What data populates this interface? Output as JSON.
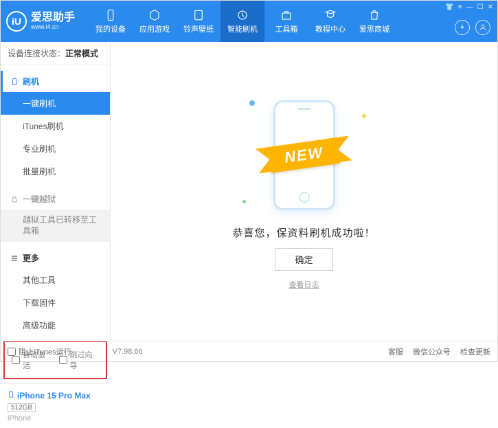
{
  "header": {
    "logo_text": "爱思助手",
    "logo_sub": "www.i4.cn",
    "logo_letter": "iU",
    "nav": [
      {
        "label": "我的设备"
      },
      {
        "label": "应用游戏"
      },
      {
        "label": "铃声壁纸"
      },
      {
        "label": "智能刷机"
      },
      {
        "label": "工具箱"
      },
      {
        "label": "教程中心"
      },
      {
        "label": "爱思商城"
      }
    ]
  },
  "sidebar": {
    "status_label": "设备连接状态：",
    "status_value": "正常模式",
    "sections": {
      "flash": {
        "title": "刷机",
        "items": [
          "一键刷机",
          "iTunes刷机",
          "专业刷机",
          "批量刷机"
        ]
      },
      "jailbreak": {
        "title": "一键越狱",
        "moved_note": "越狱工具已转移至工具箱"
      },
      "more": {
        "title": "更多",
        "items": [
          "其他工具",
          "下载固件",
          "高级功能"
        ]
      }
    },
    "checkboxes": {
      "auto_activate": "自动激活",
      "skip_guide": "跳过向导"
    },
    "device": {
      "name": "iPhone 15 Pro Max",
      "capacity": "512GB",
      "type": "iPhone"
    }
  },
  "main": {
    "ribbon": "NEW",
    "success_text": "恭喜您，保资料刷机成功啦！",
    "ok_button": "确定",
    "view_log": "查看日志"
  },
  "footer": {
    "block_itunes": "阻止iTunes运行",
    "version": "V7.98.66",
    "links": [
      "客服",
      "微信公众号",
      "检查更新"
    ]
  }
}
